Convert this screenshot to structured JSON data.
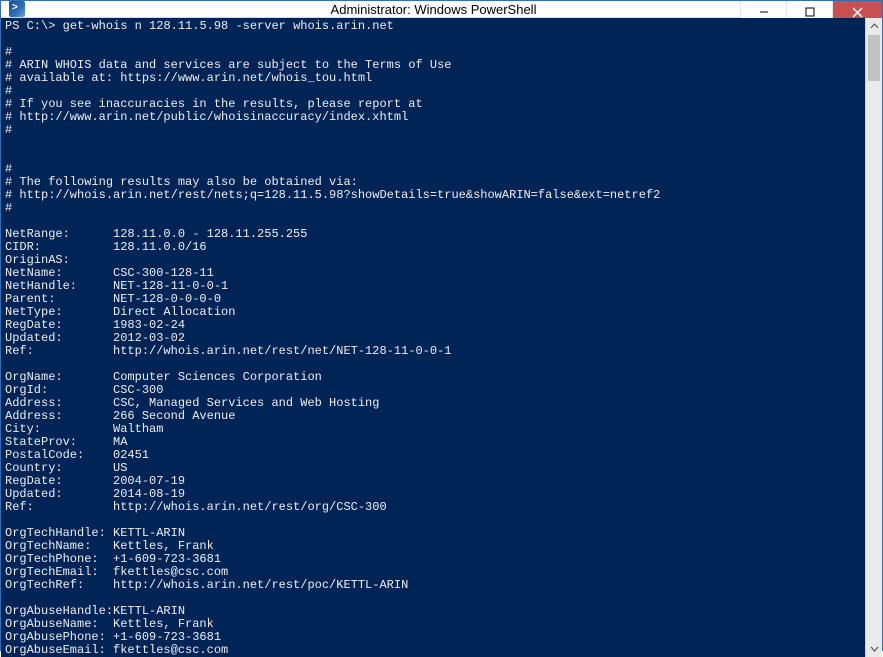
{
  "window": {
    "title": "Administrator: Windows PowerShell"
  },
  "shell": {
    "prompt": "PS C:\\>",
    "command": "get-whois n 128.11.5.98 -server whois.arin.net"
  },
  "comments": {
    "c1": "#",
    "c2": "# ARIN WHOIS data and services are subject to the Terms of Use",
    "c3": "# available at: https://www.arin.net/whois_tou.html",
    "c4": "#",
    "c5": "# If you see inaccuracies in the results, please report at",
    "c6": "# http://www.arin.net/public/whoisinaccuracy/index.xhtml",
    "c7": "#",
    "c8": "#",
    "c9": "# The following results may also be obtained via:",
    "c10": "# http://whois.arin.net/rest/nets;q=128.11.5.98?showDetails=true&showARIN=false&ext=netref2",
    "c11": "#"
  },
  "net": {
    "NetRange": "128.11.0.0 - 128.11.255.255",
    "CIDR": "128.11.0.0/16",
    "OriginAS": "",
    "NetName": "CSC-300-128-11",
    "NetHandle": "NET-128-11-0-0-1",
    "Parent": "NET-128-0-0-0-0",
    "NetType": "Direct Allocation",
    "RegDate": "1983-02-24",
    "Updated": "2012-03-02",
    "Ref": "http://whois.arin.net/rest/net/NET-128-11-0-0-1"
  },
  "org": {
    "OrgName": "Computer Sciences Corporation",
    "OrgId": "CSC-300",
    "Address1": "CSC, Managed Services and Web Hosting",
    "Address2": "266 Second Avenue",
    "City": "Waltham",
    "StateProv": "MA",
    "PostalCode": "02451",
    "Country": "US",
    "RegDate": "2004-07-19",
    "Updated": "2014-08-19",
    "Ref": "http://whois.arin.net/rest/org/CSC-300"
  },
  "tech": {
    "OrgTechHandle": "KETTL-ARIN",
    "OrgTechName": "Kettles, Frank",
    "OrgTechPhone": "+1-609-723-3681",
    "OrgTechEmail": "fkettles@csc.com",
    "OrgTechRef": "http://whois.arin.net/rest/poc/KETTL-ARIN"
  },
  "abuse": {
    "OrgAbuseHandle": "KETTL-ARIN",
    "OrgAbuseName": "Kettles, Frank",
    "OrgAbusePhone": "+1-609-723-3681",
    "OrgAbuseEmail": "fkettles@csc.com"
  },
  "labels": {
    "NetRange": "NetRange:",
    "CIDR": "CIDR:",
    "OriginAS": "OriginAS:",
    "NetName": "NetName:",
    "NetHandle": "NetHandle:",
    "Parent": "Parent:",
    "NetType": "NetType:",
    "RegDate": "RegDate:",
    "Updated": "Updated:",
    "Ref": "Ref:",
    "OrgName": "OrgName:",
    "OrgId": "OrgId:",
    "Address": "Address:",
    "City": "City:",
    "StateProv": "StateProv:",
    "PostalCode": "PostalCode:",
    "Country": "Country:",
    "OrgTechHandle": "OrgTechHandle:",
    "OrgTechName": "OrgTechName:",
    "OrgTechPhone": "OrgTechPhone:",
    "OrgTechEmail": "OrgTechEmail:",
    "OrgTechRef": "OrgTechRef:",
    "OrgAbuseHandle": "OrgAbuseHandle:",
    "OrgAbuseName": "OrgAbuseName:",
    "OrgAbusePhone": "OrgAbusePhone:",
    "OrgAbuseEmail": "OrgAbuseEmail:"
  }
}
